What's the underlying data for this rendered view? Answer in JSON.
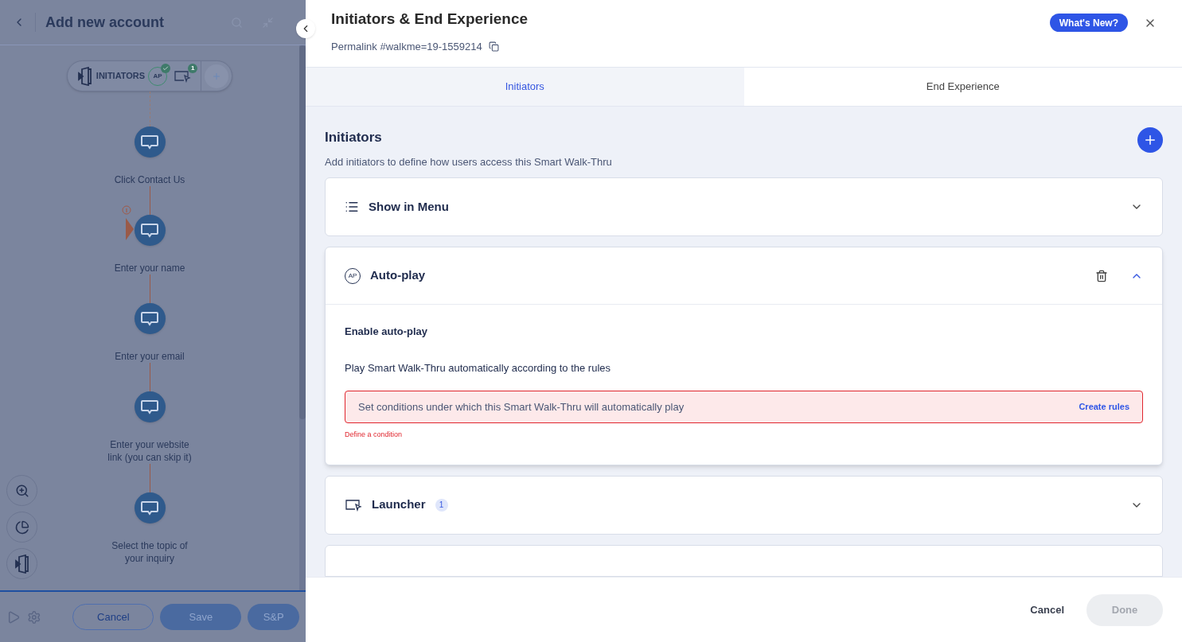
{
  "editor": {
    "title": "Add new account",
    "initiators_bar": {
      "label": "INITIATORS",
      "autoplay_badge": "AP",
      "autoplay_checked": true,
      "launcher_count": "1"
    },
    "steps": [
      {
        "label": "Click Contact Us",
        "warning": false
      },
      {
        "label": "Enter your name",
        "warning": true
      },
      {
        "label": "Enter your email",
        "warning": false
      },
      {
        "label": "Enter your website link (you can skip it)",
        "warning": false
      },
      {
        "label": "Select the topic of your inquiry",
        "warning": false
      }
    ],
    "footer_buttons": [
      {
        "label": "Cancel",
        "kind": "outline"
      },
      {
        "label": "Save",
        "kind": "filled"
      },
      {
        "label": "S&P",
        "kind": "filled"
      }
    ]
  },
  "panel": {
    "title": "Initiators & End Experience",
    "permalink": "Permalink #walkme=19-1559214",
    "whats_new": "What's New?",
    "tabs": [
      {
        "label": "Initiators",
        "selected": true
      },
      {
        "label": "End Experience",
        "selected": false
      }
    ],
    "section": {
      "title": "Initiators",
      "subtitle": "Add initiators to define how users access this Smart Walk-Thru"
    },
    "accordions": [
      {
        "kind": "menu",
        "title": "Show in Menu",
        "expanded": false
      },
      {
        "kind": "autoplay",
        "title": "Auto-play",
        "expanded": true,
        "icon_text": "AP",
        "enable_label": "Enable auto-play",
        "description": "Play Smart Walk-Thru automatically according to the rules",
        "condition_text": "Set conditions under which this Smart Walk-Thru will automatically play",
        "create_rules": "Create rules",
        "error": "Define a condition"
      },
      {
        "kind": "launcher",
        "title": "Launcher",
        "expanded": false,
        "count": "1"
      }
    ],
    "footer_buttons": [
      {
        "label": "Cancel",
        "disabled": false
      },
      {
        "label": "Done",
        "disabled": true
      }
    ]
  }
}
